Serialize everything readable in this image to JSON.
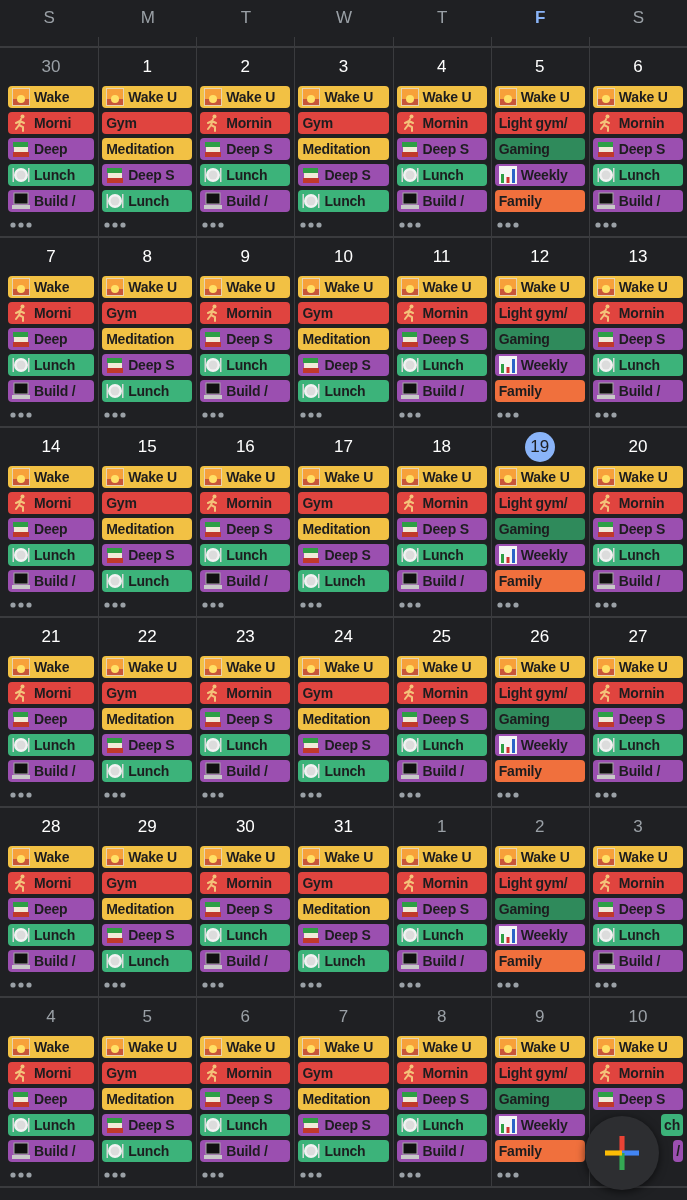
{
  "weekdays": [
    {
      "label": "S",
      "today": false
    },
    {
      "label": "M",
      "today": false
    },
    {
      "label": "T",
      "today": false
    },
    {
      "label": "W",
      "today": false
    },
    {
      "label": "T",
      "today": false
    },
    {
      "label": "F",
      "today": true
    },
    {
      "label": "S",
      "today": false
    }
  ],
  "weeks": [
    {
      "days": [
        {
          "date": "30",
          "in_month": false,
          "today": false,
          "events": [
            {
              "kind": "sunrise",
              "title": "Wake",
              "color": "#f2c144"
            },
            {
              "kind": "runner",
              "title": "Morni",
              "color": "#e0443f"
            },
            {
              "kind": "books",
              "title": "Deep",
              "color": "#9b4fb0"
            },
            {
              "kind": "plate",
              "title": "Lunch",
              "color": "#3cb37a"
            },
            {
              "kind": "laptop",
              "title": "Build /",
              "color": "#9b4fb0"
            }
          ]
        },
        {
          "date": "1",
          "in_month": true,
          "today": false,
          "events": [
            {
              "kind": "sunrise",
              "title": "Wake U",
              "color": "#f2c144"
            },
            {
              "kind": "plain",
              "title": "Gym",
              "color": "#e0443f"
            },
            {
              "kind": "plain",
              "title": "Meditation",
              "color": "#f2c144"
            },
            {
              "kind": "books",
              "title": "Deep S",
              "color": "#9b4fb0"
            },
            {
              "kind": "plate",
              "title": "Lunch",
              "color": "#3cb37a"
            }
          ]
        },
        {
          "date": "2",
          "in_month": true,
          "today": false,
          "events": [
            {
              "kind": "sunrise",
              "title": "Wake U",
              "color": "#f2c144"
            },
            {
              "kind": "runner",
              "title": "Mornin",
              "color": "#e0443f"
            },
            {
              "kind": "books",
              "title": "Deep S",
              "color": "#9b4fb0"
            },
            {
              "kind": "plate",
              "title": "Lunch",
              "color": "#3cb37a"
            },
            {
              "kind": "laptop",
              "title": "Build /",
              "color": "#9b4fb0"
            }
          ]
        },
        {
          "date": "3",
          "in_month": true,
          "today": false,
          "events": [
            {
              "kind": "sunrise",
              "title": "Wake U",
              "color": "#f2c144"
            },
            {
              "kind": "plain",
              "title": "Gym",
              "color": "#e0443f"
            },
            {
              "kind": "plain",
              "title": "Meditation",
              "color": "#f2c144"
            },
            {
              "kind": "books",
              "title": "Deep S",
              "color": "#9b4fb0"
            },
            {
              "kind": "plate",
              "title": "Lunch",
              "color": "#3cb37a"
            }
          ]
        },
        {
          "date": "4",
          "in_month": true,
          "today": false,
          "events": [
            {
              "kind": "sunrise",
              "title": "Wake U",
              "color": "#f2c144"
            },
            {
              "kind": "runner",
              "title": "Mornin",
              "color": "#e0443f"
            },
            {
              "kind": "books",
              "title": "Deep S",
              "color": "#9b4fb0"
            },
            {
              "kind": "plate",
              "title": "Lunch",
              "color": "#3cb37a"
            },
            {
              "kind": "laptop",
              "title": "Build /",
              "color": "#9b4fb0"
            }
          ]
        },
        {
          "date": "5",
          "in_month": true,
          "today": false,
          "events": [
            {
              "kind": "sunrise",
              "title": "Wake U",
              "color": "#f2c144"
            },
            {
              "kind": "plain",
              "title": "Light gym/",
              "color": "#e0443f"
            },
            {
              "kind": "plain",
              "title": "Gaming",
              "color": "#2f8a5b"
            },
            {
              "kind": "chart",
              "title": "Weekly",
              "color": "#9b4fb0"
            },
            {
              "kind": "plain",
              "title": "Family",
              "color": "#f0703d"
            }
          ]
        },
        {
          "date": "6",
          "in_month": true,
          "today": false,
          "events": [
            {
              "kind": "sunrise",
              "title": "Wake U",
              "color": "#f2c144"
            },
            {
              "kind": "runner",
              "title": "Mornin",
              "color": "#e0443f"
            },
            {
              "kind": "books",
              "title": "Deep S",
              "color": "#9b4fb0"
            },
            {
              "kind": "plate",
              "title": "Lunch",
              "color": "#3cb37a"
            },
            {
              "kind": "laptop",
              "title": "Build /",
              "color": "#9b4fb0"
            }
          ]
        }
      ]
    },
    {
      "days": [
        {
          "date": "7",
          "in_month": true,
          "today": false,
          "events": [
            {
              "kind": "sunrise",
              "title": "Wake",
              "color": "#f2c144"
            },
            {
              "kind": "runner",
              "title": "Morni",
              "color": "#e0443f"
            },
            {
              "kind": "books",
              "title": "Deep",
              "color": "#9b4fb0"
            },
            {
              "kind": "plate",
              "title": "Lunch",
              "color": "#3cb37a"
            },
            {
              "kind": "laptop",
              "title": "Build /",
              "color": "#9b4fb0"
            }
          ]
        },
        {
          "date": "8",
          "in_month": true,
          "today": false,
          "events": [
            {
              "kind": "sunrise",
              "title": "Wake U",
              "color": "#f2c144"
            },
            {
              "kind": "plain",
              "title": "Gym",
              "color": "#e0443f"
            },
            {
              "kind": "plain",
              "title": "Meditation",
              "color": "#f2c144"
            },
            {
              "kind": "books",
              "title": "Deep S",
              "color": "#9b4fb0"
            },
            {
              "kind": "plate",
              "title": "Lunch",
              "color": "#3cb37a"
            }
          ]
        },
        {
          "date": "9",
          "in_month": true,
          "today": false,
          "events": [
            {
              "kind": "sunrise",
              "title": "Wake U",
              "color": "#f2c144"
            },
            {
              "kind": "runner",
              "title": "Mornin",
              "color": "#e0443f"
            },
            {
              "kind": "books",
              "title": "Deep S",
              "color": "#9b4fb0"
            },
            {
              "kind": "plate",
              "title": "Lunch",
              "color": "#3cb37a"
            },
            {
              "kind": "laptop",
              "title": "Build /",
              "color": "#9b4fb0"
            }
          ]
        },
        {
          "date": "10",
          "in_month": true,
          "today": false,
          "events": [
            {
              "kind": "sunrise",
              "title": "Wake U",
              "color": "#f2c144"
            },
            {
              "kind": "plain",
              "title": "Gym",
              "color": "#e0443f"
            },
            {
              "kind": "plain",
              "title": "Meditation",
              "color": "#f2c144"
            },
            {
              "kind": "books",
              "title": "Deep S",
              "color": "#9b4fb0"
            },
            {
              "kind": "plate",
              "title": "Lunch",
              "color": "#3cb37a"
            }
          ]
        },
        {
          "date": "11",
          "in_month": true,
          "today": false,
          "events": [
            {
              "kind": "sunrise",
              "title": "Wake U",
              "color": "#f2c144"
            },
            {
              "kind": "runner",
              "title": "Mornin",
              "color": "#e0443f"
            },
            {
              "kind": "books",
              "title": "Deep S",
              "color": "#9b4fb0"
            },
            {
              "kind": "plate",
              "title": "Lunch",
              "color": "#3cb37a"
            },
            {
              "kind": "laptop",
              "title": "Build /",
              "color": "#9b4fb0"
            }
          ]
        },
        {
          "date": "12",
          "in_month": true,
          "today": false,
          "events": [
            {
              "kind": "sunrise",
              "title": "Wake U",
              "color": "#f2c144"
            },
            {
              "kind": "plain",
              "title": "Light gym/",
              "color": "#e0443f"
            },
            {
              "kind": "plain",
              "title": "Gaming",
              "color": "#2f8a5b"
            },
            {
              "kind": "chart",
              "title": "Weekly",
              "color": "#9b4fb0"
            },
            {
              "kind": "plain",
              "title": "Family",
              "color": "#f0703d"
            }
          ]
        },
        {
          "date": "13",
          "in_month": true,
          "today": false,
          "events": [
            {
              "kind": "sunrise",
              "title": "Wake U",
              "color": "#f2c144"
            },
            {
              "kind": "runner",
              "title": "Mornin",
              "color": "#e0443f"
            },
            {
              "kind": "books",
              "title": "Deep S",
              "color": "#9b4fb0"
            },
            {
              "kind": "plate",
              "title": "Lunch",
              "color": "#3cb37a"
            },
            {
              "kind": "laptop",
              "title": "Build /",
              "color": "#9b4fb0"
            }
          ]
        }
      ]
    },
    {
      "days": [
        {
          "date": "14",
          "in_month": true,
          "today": false,
          "events": [
            {
              "kind": "sunrise",
              "title": "Wake",
              "color": "#f2c144"
            },
            {
              "kind": "runner",
              "title": "Morni",
              "color": "#e0443f"
            },
            {
              "kind": "books",
              "title": "Deep",
              "color": "#9b4fb0"
            },
            {
              "kind": "plate",
              "title": "Lunch",
              "color": "#3cb37a"
            },
            {
              "kind": "laptop",
              "title": "Build /",
              "color": "#9b4fb0"
            }
          ]
        },
        {
          "date": "15",
          "in_month": true,
          "today": false,
          "events": [
            {
              "kind": "sunrise",
              "title": "Wake U",
              "color": "#f2c144"
            },
            {
              "kind": "plain",
              "title": "Gym",
              "color": "#e0443f"
            },
            {
              "kind": "plain",
              "title": "Meditation",
              "color": "#f2c144"
            },
            {
              "kind": "books",
              "title": "Deep S",
              "color": "#9b4fb0"
            },
            {
              "kind": "plate",
              "title": "Lunch",
              "color": "#3cb37a"
            }
          ]
        },
        {
          "date": "16",
          "in_month": true,
          "today": false,
          "events": [
            {
              "kind": "sunrise",
              "title": "Wake U",
              "color": "#f2c144"
            },
            {
              "kind": "runner",
              "title": "Mornin",
              "color": "#e0443f"
            },
            {
              "kind": "books",
              "title": "Deep S",
              "color": "#9b4fb0"
            },
            {
              "kind": "plate",
              "title": "Lunch",
              "color": "#3cb37a"
            },
            {
              "kind": "laptop",
              "title": "Build /",
              "color": "#9b4fb0"
            }
          ]
        },
        {
          "date": "17",
          "in_month": true,
          "today": false,
          "events": [
            {
              "kind": "sunrise",
              "title": "Wake U",
              "color": "#f2c144"
            },
            {
              "kind": "plain",
              "title": "Gym",
              "color": "#e0443f"
            },
            {
              "kind": "plain",
              "title": "Meditation",
              "color": "#f2c144"
            },
            {
              "kind": "books",
              "title": "Deep S",
              "color": "#9b4fb0"
            },
            {
              "kind": "plate",
              "title": "Lunch",
              "color": "#3cb37a"
            }
          ]
        },
        {
          "date": "18",
          "in_month": true,
          "today": false,
          "events": [
            {
              "kind": "sunrise",
              "title": "Wake U",
              "color": "#f2c144"
            },
            {
              "kind": "runner",
              "title": "Mornin",
              "color": "#e0443f"
            },
            {
              "kind": "books",
              "title": "Deep S",
              "color": "#9b4fb0"
            },
            {
              "kind": "plate",
              "title": "Lunch",
              "color": "#3cb37a"
            },
            {
              "kind": "laptop",
              "title": "Build /",
              "color": "#9b4fb0"
            }
          ]
        },
        {
          "date": "19",
          "in_month": true,
          "today": true,
          "events": [
            {
              "kind": "sunrise",
              "title": "Wake U",
              "color": "#f2c144"
            },
            {
              "kind": "plain",
              "title": "Light gym/",
              "color": "#e0443f"
            },
            {
              "kind": "plain",
              "title": "Gaming",
              "color": "#2f8a5b"
            },
            {
              "kind": "chart",
              "title": "Weekly",
              "color": "#9b4fb0"
            },
            {
              "kind": "plain",
              "title": "Family",
              "color": "#f0703d"
            }
          ]
        },
        {
          "date": "20",
          "in_month": true,
          "today": false,
          "events": [
            {
              "kind": "sunrise",
              "title": "Wake U",
              "color": "#f2c144"
            },
            {
              "kind": "runner",
              "title": "Mornin",
              "color": "#e0443f"
            },
            {
              "kind": "books",
              "title": "Deep S",
              "color": "#9b4fb0"
            },
            {
              "kind": "plate",
              "title": "Lunch",
              "color": "#3cb37a"
            },
            {
              "kind": "laptop",
              "title": "Build /",
              "color": "#9b4fb0"
            }
          ]
        }
      ]
    },
    {
      "days": [
        {
          "date": "21",
          "in_month": true,
          "today": false,
          "events": [
            {
              "kind": "sunrise",
              "title": "Wake",
              "color": "#f2c144"
            },
            {
              "kind": "runner",
              "title": "Morni",
              "color": "#e0443f"
            },
            {
              "kind": "books",
              "title": "Deep",
              "color": "#9b4fb0"
            },
            {
              "kind": "plate",
              "title": "Lunch",
              "color": "#3cb37a"
            },
            {
              "kind": "laptop",
              "title": "Build /",
              "color": "#9b4fb0"
            }
          ]
        },
        {
          "date": "22",
          "in_month": true,
          "today": false,
          "events": [
            {
              "kind": "sunrise",
              "title": "Wake U",
              "color": "#f2c144"
            },
            {
              "kind": "plain",
              "title": "Gym",
              "color": "#e0443f"
            },
            {
              "kind": "plain",
              "title": "Meditation",
              "color": "#f2c144"
            },
            {
              "kind": "books",
              "title": "Deep S",
              "color": "#9b4fb0"
            },
            {
              "kind": "plate",
              "title": "Lunch",
              "color": "#3cb37a"
            }
          ]
        },
        {
          "date": "23",
          "in_month": true,
          "today": false,
          "events": [
            {
              "kind": "sunrise",
              "title": "Wake U",
              "color": "#f2c144"
            },
            {
              "kind": "runner",
              "title": "Mornin",
              "color": "#e0443f"
            },
            {
              "kind": "books",
              "title": "Deep S",
              "color": "#9b4fb0"
            },
            {
              "kind": "plate",
              "title": "Lunch",
              "color": "#3cb37a"
            },
            {
              "kind": "laptop",
              "title": "Build /",
              "color": "#9b4fb0"
            }
          ]
        },
        {
          "date": "24",
          "in_month": true,
          "today": false,
          "events": [
            {
              "kind": "sunrise",
              "title": "Wake U",
              "color": "#f2c144"
            },
            {
              "kind": "plain",
              "title": "Gym",
              "color": "#e0443f"
            },
            {
              "kind": "plain",
              "title": "Meditation",
              "color": "#f2c144"
            },
            {
              "kind": "books",
              "title": "Deep S",
              "color": "#9b4fb0"
            },
            {
              "kind": "plate",
              "title": "Lunch",
              "color": "#3cb37a"
            }
          ]
        },
        {
          "date": "25",
          "in_month": true,
          "today": false,
          "events": [
            {
              "kind": "sunrise",
              "title": "Wake U",
              "color": "#f2c144"
            },
            {
              "kind": "runner",
              "title": "Mornin",
              "color": "#e0443f"
            },
            {
              "kind": "books",
              "title": "Deep S",
              "color": "#9b4fb0"
            },
            {
              "kind": "plate",
              "title": "Lunch",
              "color": "#3cb37a"
            },
            {
              "kind": "laptop",
              "title": "Build /",
              "color": "#9b4fb0"
            }
          ]
        },
        {
          "date": "26",
          "in_month": true,
          "today": false,
          "events": [
            {
              "kind": "sunrise",
              "title": "Wake U",
              "color": "#f2c144"
            },
            {
              "kind": "plain",
              "title": "Light gym/",
              "color": "#e0443f"
            },
            {
              "kind": "plain",
              "title": "Gaming",
              "color": "#2f8a5b"
            },
            {
              "kind": "chart",
              "title": "Weekly",
              "color": "#9b4fb0"
            },
            {
              "kind": "plain",
              "title": "Family",
              "color": "#f0703d"
            }
          ]
        },
        {
          "date": "27",
          "in_month": true,
          "today": false,
          "events": [
            {
              "kind": "sunrise",
              "title": "Wake U",
              "color": "#f2c144"
            },
            {
              "kind": "runner",
              "title": "Mornin",
              "color": "#e0443f"
            },
            {
              "kind": "books",
              "title": "Deep S",
              "color": "#9b4fb0"
            },
            {
              "kind": "plate",
              "title": "Lunch",
              "color": "#3cb37a"
            },
            {
              "kind": "laptop",
              "title": "Build /",
              "color": "#9b4fb0"
            }
          ]
        }
      ]
    },
    {
      "days": [
        {
          "date": "28",
          "in_month": true,
          "today": false,
          "events": [
            {
              "kind": "sunrise",
              "title": "Wake",
              "color": "#f2c144"
            },
            {
              "kind": "runner",
              "title": "Morni",
              "color": "#e0443f"
            },
            {
              "kind": "books",
              "title": "Deep",
              "color": "#9b4fb0"
            },
            {
              "kind": "plate",
              "title": "Lunch",
              "color": "#3cb37a"
            },
            {
              "kind": "laptop",
              "title": "Build /",
              "color": "#9b4fb0"
            }
          ]
        },
        {
          "date": "29",
          "in_month": true,
          "today": false,
          "events": [
            {
              "kind": "sunrise",
              "title": "Wake U",
              "color": "#f2c144"
            },
            {
              "kind": "plain",
              "title": "Gym",
              "color": "#e0443f"
            },
            {
              "kind": "plain",
              "title": "Meditation",
              "color": "#f2c144"
            },
            {
              "kind": "books",
              "title": "Deep S",
              "color": "#9b4fb0"
            },
            {
              "kind": "plate",
              "title": "Lunch",
              "color": "#3cb37a"
            }
          ]
        },
        {
          "date": "30",
          "in_month": true,
          "today": false,
          "events": [
            {
              "kind": "sunrise",
              "title": "Wake U",
              "color": "#f2c144"
            },
            {
              "kind": "runner",
              "title": "Mornin",
              "color": "#e0443f"
            },
            {
              "kind": "books",
              "title": "Deep S",
              "color": "#9b4fb0"
            },
            {
              "kind": "plate",
              "title": "Lunch",
              "color": "#3cb37a"
            },
            {
              "kind": "laptop",
              "title": "Build /",
              "color": "#9b4fb0"
            }
          ]
        },
        {
          "date": "31",
          "in_month": true,
          "today": false,
          "events": [
            {
              "kind": "sunrise",
              "title": "Wake U",
              "color": "#f2c144"
            },
            {
              "kind": "plain",
              "title": "Gym",
              "color": "#e0443f"
            },
            {
              "kind": "plain",
              "title": "Meditation",
              "color": "#f2c144"
            },
            {
              "kind": "books",
              "title": "Deep S",
              "color": "#9b4fb0"
            },
            {
              "kind": "plate",
              "title": "Lunch",
              "color": "#3cb37a"
            }
          ]
        },
        {
          "date": "1",
          "in_month": false,
          "today": false,
          "events": [
            {
              "kind": "sunrise",
              "title": "Wake U",
              "color": "#f2c144"
            },
            {
              "kind": "runner",
              "title": "Mornin",
              "color": "#e0443f"
            },
            {
              "kind": "books",
              "title": "Deep S",
              "color": "#9b4fb0"
            },
            {
              "kind": "plate",
              "title": "Lunch",
              "color": "#3cb37a"
            },
            {
              "kind": "laptop",
              "title": "Build /",
              "color": "#9b4fb0"
            }
          ]
        },
        {
          "date": "2",
          "in_month": false,
          "today": false,
          "events": [
            {
              "kind": "sunrise",
              "title": "Wake U",
              "color": "#f2c144"
            },
            {
              "kind": "plain",
              "title": "Light gym/",
              "color": "#e0443f"
            },
            {
              "kind": "plain",
              "title": "Gaming",
              "color": "#2f8a5b"
            },
            {
              "kind": "chart",
              "title": "Weekly",
              "color": "#9b4fb0"
            },
            {
              "kind": "plain",
              "title": "Family",
              "color": "#f0703d"
            }
          ]
        },
        {
          "date": "3",
          "in_month": false,
          "today": false,
          "events": [
            {
              "kind": "sunrise",
              "title": "Wake U",
              "color": "#f2c144"
            },
            {
              "kind": "runner",
              "title": "Mornin",
              "color": "#e0443f"
            },
            {
              "kind": "books",
              "title": "Deep S",
              "color": "#9b4fb0"
            },
            {
              "kind": "plate",
              "title": "Lunch",
              "color": "#3cb37a"
            },
            {
              "kind": "laptop",
              "title": "Build /",
              "color": "#9b4fb0"
            }
          ]
        }
      ]
    },
    {
      "days": [
        {
          "date": "4",
          "in_month": false,
          "today": false,
          "events": [
            {
              "kind": "sunrise",
              "title": "Wake",
              "color": "#f2c144"
            },
            {
              "kind": "runner",
              "title": "Morni",
              "color": "#e0443f"
            },
            {
              "kind": "books",
              "title": "Deep",
              "color": "#9b4fb0"
            },
            {
              "kind": "plate",
              "title": "Lunch",
              "color": "#3cb37a"
            },
            {
              "kind": "laptop",
              "title": "Build /",
              "color": "#9b4fb0"
            }
          ]
        },
        {
          "date": "5",
          "in_month": false,
          "today": false,
          "events": [
            {
              "kind": "sunrise",
              "title": "Wake U",
              "color": "#f2c144"
            },
            {
              "kind": "plain",
              "title": "Gym",
              "color": "#e0443f"
            },
            {
              "kind": "plain",
              "title": "Meditation",
              "color": "#f2c144"
            },
            {
              "kind": "books",
              "title": "Deep S",
              "color": "#9b4fb0"
            },
            {
              "kind": "plate",
              "title": "Lunch",
              "color": "#3cb37a"
            }
          ]
        },
        {
          "date": "6",
          "in_month": false,
          "today": false,
          "events": [
            {
              "kind": "sunrise",
              "title": "Wake U",
              "color": "#f2c144"
            },
            {
              "kind": "runner",
              "title": "Mornin",
              "color": "#e0443f"
            },
            {
              "kind": "books",
              "title": "Deep S",
              "color": "#9b4fb0"
            },
            {
              "kind": "plate",
              "title": "Lunch",
              "color": "#3cb37a"
            },
            {
              "kind": "laptop",
              "title": "Build /",
              "color": "#9b4fb0"
            }
          ]
        },
        {
          "date": "7",
          "in_month": false,
          "today": false,
          "events": [
            {
              "kind": "sunrise",
              "title": "Wake U",
              "color": "#f2c144"
            },
            {
              "kind": "plain",
              "title": "Gym",
              "color": "#e0443f"
            },
            {
              "kind": "plain",
              "title": "Meditation",
              "color": "#f2c144"
            },
            {
              "kind": "books",
              "title": "Deep S",
              "color": "#9b4fb0"
            },
            {
              "kind": "plate",
              "title": "Lunch",
              "color": "#3cb37a"
            }
          ]
        },
        {
          "date": "8",
          "in_month": false,
          "today": false,
          "events": [
            {
              "kind": "sunrise",
              "title": "Wake U",
              "color": "#f2c144"
            },
            {
              "kind": "runner",
              "title": "Mornin",
              "color": "#e0443f"
            },
            {
              "kind": "books",
              "title": "Deep S",
              "color": "#9b4fb0"
            },
            {
              "kind": "plate",
              "title": "Lunch",
              "color": "#3cb37a"
            },
            {
              "kind": "laptop",
              "title": "Build /",
              "color": "#9b4fb0"
            }
          ]
        },
        {
          "date": "9",
          "in_month": false,
          "today": false,
          "events": [
            {
              "kind": "sunrise",
              "title": "Wake U",
              "color": "#f2c144"
            },
            {
              "kind": "plain",
              "title": "Light gym/",
              "color": "#e0443f"
            },
            {
              "kind": "plain",
              "title": "Gaming",
              "color": "#2f8a5b"
            },
            {
              "kind": "chart",
              "title": "Weekly",
              "color": "#9b4fb0"
            },
            {
              "kind": "plain",
              "title": "Family",
              "color": "#f0703d"
            }
          ]
        },
        {
          "date": "10",
          "in_month": false,
          "today": false,
          "more": false,
          "events": [
            {
              "kind": "sunrise",
              "title": "Wake U",
              "color": "#f2c144"
            },
            {
              "kind": "runner",
              "title": "Mornin",
              "color": "#e0443f"
            },
            {
              "kind": "books",
              "title": "Deep S",
              "color": "#9b4fb0"
            },
            {
              "kind": "covered",
              "title": "ch",
              "color": "#3cb37a"
            },
            {
              "kind": "covered",
              "title": "/",
              "color": "#9b4fb0"
            }
          ]
        }
      ]
    }
  ]
}
